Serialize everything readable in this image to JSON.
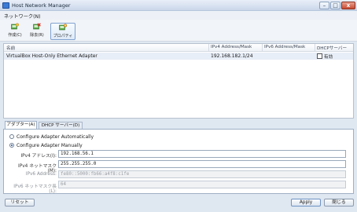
{
  "window": {
    "title": "Host Network Manager",
    "min": "–",
    "max": "□",
    "close": "x"
  },
  "menu": {
    "network": "ネットワーク(N)"
  },
  "toolbar": {
    "create": "作成(C)",
    "remove": "除去(R)",
    "properties": "プロパティ"
  },
  "table": {
    "columns": [
      "名前",
      "IPv4 Address/Mask",
      "IPv6 Address/Mask",
      "DHCPサーバー"
    ],
    "rows": [
      {
        "name": "VirtualBox Host-Only Ethernet Adapter",
        "ipv4": "192.168.182.1/24",
        "ipv6": "",
        "dhcp": "有効"
      }
    ]
  },
  "tabs": {
    "adapter": "アダプター(A)",
    "dhcp": "DHCP サーバー(D)"
  },
  "adapter": {
    "auto_label": "Configure Adapter Automatically",
    "manual_label": "Configure Adapter Manually",
    "ipv4_label": "IPv4 アドレス(I):",
    "ipv4_value": "192.168.56.1",
    "mask_label": "IPv4 ネットマスク(M):",
    "mask_value": "255.255.255.0",
    "ipv6_label": "IPv6 Address:",
    "ipv6_value": "fe80::5000:fb66:a4f8:c1fe",
    "prefix_label": "IPv6 ネットマスク長(L):",
    "prefix_value": "64"
  },
  "buttons": {
    "reset": "リセット",
    "apply": "Apply",
    "close": "閉じる"
  }
}
